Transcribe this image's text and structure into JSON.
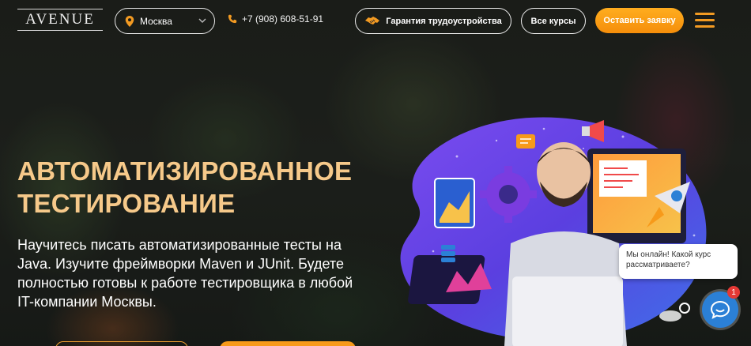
{
  "header": {
    "logo_text": "AVENUE",
    "city": "Москва",
    "phone": "+7 (908) 608-51-91",
    "guarantee_label": "Гарантия трудоустройства",
    "all_courses_label": "Все курсы",
    "apply_label": "Оставить заявку"
  },
  "hero": {
    "title_line1": "АВТОМАТИЗИРОВАННОЕ",
    "title_line2": "ТЕСТИРОВАНИЕ",
    "description": "Научитесь писать автоматизированные тесты на Java. Изучите фреймворки Maven и JUnit. Будете полностью готовы к работе тестировщика в любой IT-компании Москвы."
  },
  "chat": {
    "message": "Мы онлайн! Какой курс рассматриваете?",
    "badge_count": "1"
  },
  "colors": {
    "accent_orange": "#f79a1a",
    "title_gold": "#f6c98a",
    "chat_blue": "#2b80d6",
    "badge_red": "#e53935",
    "illustration_purple": "#6a3fe0"
  },
  "icons": [
    "location-pin-icon",
    "chevron-down-icon",
    "phone-icon",
    "handshake-icon",
    "menu-icon",
    "chat-icon"
  ]
}
